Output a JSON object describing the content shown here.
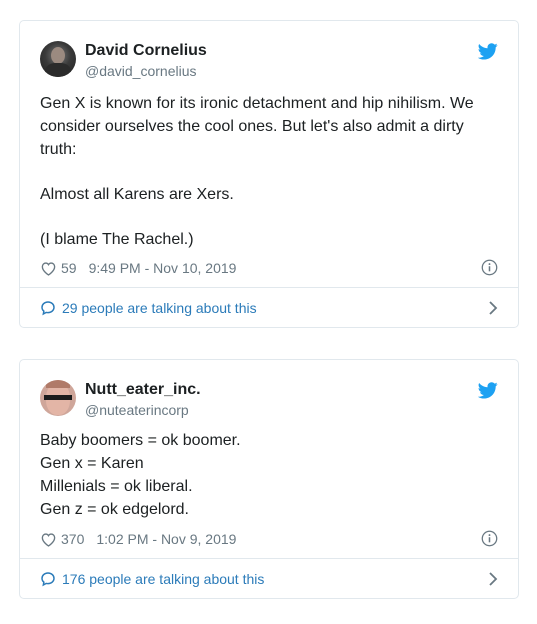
{
  "tweets": [
    {
      "author_name": "David Cornelius",
      "author_handle": "@david_cornelius",
      "paragraphs": [
        "Gen X is known for its ironic detachment and hip nihilism. We consider ourselves the cool ones. But let's also admit a dirty truth:",
        "Almost all Karens are Xers.",
        "(I blame The Rachel.)"
      ],
      "likes": "59",
      "timestamp": "9:49 PM - Nov 10, 2019",
      "conversation_label": "29 people are talking about this"
    },
    {
      "author_name": "Nutt_eater_inc.",
      "author_handle": "@nuteaterincorp",
      "lines": [
        "Baby boomers = ok boomer.",
        "Gen x = Karen",
        "Millenials = ok liberal.",
        "Gen z = ok edgelord."
      ],
      "likes": "370",
      "timestamp": "1:02 PM - Nov 9, 2019",
      "conversation_label": "176 people are talking about this"
    }
  ],
  "icons": {
    "brand": "twitter-bird-icon",
    "like": "heart-icon",
    "info": "info-icon",
    "reply": "speech-bubble-icon",
    "more": "chevron-right-icon"
  },
  "colors": {
    "brand_blue": "#1da1f2",
    "link_blue": "#2b7bb9",
    "muted_gray": "#697882",
    "border": "#e1e8ed",
    "text": "#1c2022"
  }
}
